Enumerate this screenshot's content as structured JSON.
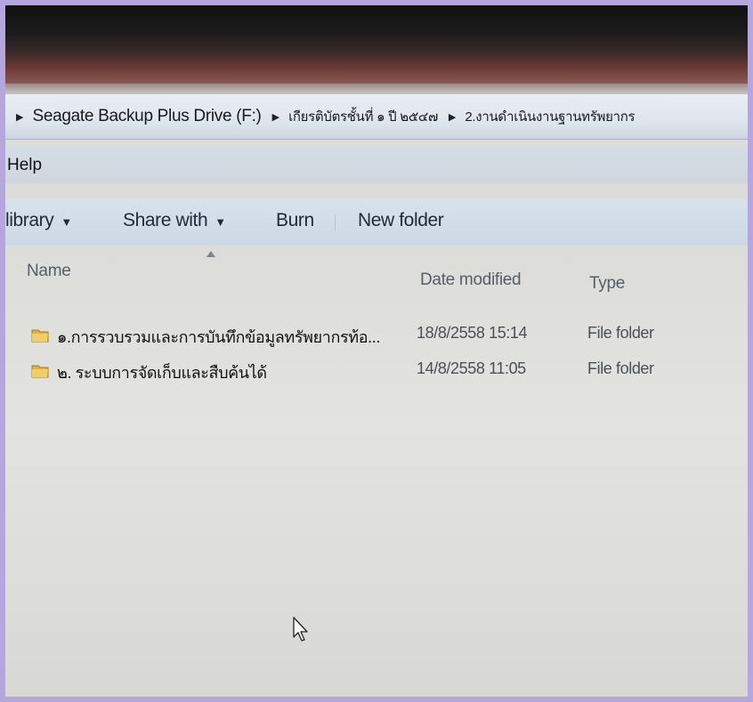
{
  "breadcrumb": {
    "items": [
      {
        "label": "Seagate Backup Plus Drive (F:)"
      },
      {
        "label": "เกียรติบัตรชั้นที่ ๑ ปี ๒๕๔๗"
      },
      {
        "label": "2.งานดำเนินงานฐานทรัพยากร"
      }
    ]
  },
  "menu": {
    "help_label": "Help"
  },
  "toolbar": {
    "library_label": "library",
    "share_label": "Share with",
    "burn_label": "Burn",
    "new_folder_label": "New folder"
  },
  "columns": {
    "name": "Name",
    "date": "Date modified",
    "type": "Type"
  },
  "files": [
    {
      "name": "๑.การรวบรวมและการบันทึกข้อมูลทรัพยากรท้อ...",
      "date": "18/8/2558 15:14",
      "type": "File folder"
    },
    {
      "name": "๒. ระบบการจัดเก็บและสืบค้นได้",
      "date": "14/8/2558 11:05",
      "type": "File folder"
    }
  ],
  "colors": {
    "background": "#b6a6df",
    "folder": "#d9b04a",
    "toolbar": "#d4dee8"
  },
  "icons": {
    "folder": "folder-icon",
    "cursor": "mouse-pointer-icon",
    "breadcrumb_separator": "chevron-right-icon"
  }
}
